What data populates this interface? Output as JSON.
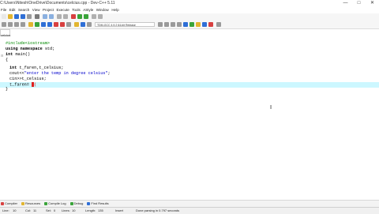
{
  "window": {
    "title": "C:\\Users\\Nitesh\\OneDrive\\Documents\\celcius.cpp - Dev-C++ 5.11",
    "controls": [
      "—",
      "□",
      "✕"
    ]
  },
  "menu": [
    "File",
    "Edit",
    "Search",
    "View",
    "Project",
    "Execute",
    "Tools",
    "AStyle",
    "Window",
    "Help"
  ],
  "toolbar": {
    "compiler_select": "TDM-GCC 4.9.2 64-bit Release",
    "colors": {
      "green": "#3aa43a",
      "blue": "#2f6fd6",
      "red": "#d84040",
      "yellow": "#e2b530",
      "gray": "#9a9a9a"
    }
  },
  "side": {
    "selector": ""
  },
  "tabs": [
    {
      "label": "celcius"
    }
  ],
  "editor": {
    "lines": [
      {
        "pp": "#include<iostream>"
      },
      {
        "kw": "using namespace",
        "text": " std;"
      },
      {
        "kw": "int",
        "text": " main()"
      },
      {
        "text": "{"
      },
      {
        "text": ""
      },
      {
        "kw": "int",
        "text": " t_faren,t_celsius;"
      },
      {
        "text": "cout<<",
        "str": "\"enter the temp in degree celsius\"",
        "tail": ";"
      },
      {
        "text": "cin>>t_celsius;"
      },
      {
        "text": "t_faren= ",
        "caret": "("
      },
      {
        "text": "}"
      }
    ],
    "highlight_color": "#ccf7ff"
  },
  "bottom_tabs": [
    "Compiler",
    "Resources",
    "Compile Log",
    "Debug",
    "Find Results"
  ],
  "status": {
    "line_label": "Line:",
    "line_value": "10",
    "col_label": "Col:",
    "col_value": "11",
    "sel_label": "Sel:",
    "sel_value": "0",
    "lines_label": "Lines:",
    "lines_value": "10",
    "length_label": "Length:",
    "length_value": "135",
    "mode": "Insert",
    "message": "Done parsing in 0.797 seconds"
  }
}
